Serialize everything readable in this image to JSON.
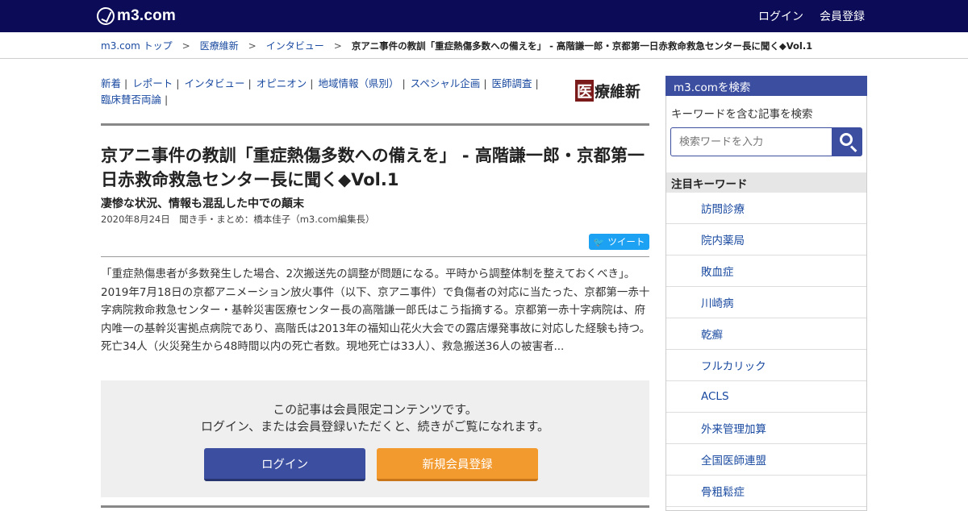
{
  "header": {
    "logo_text": "m3.com",
    "login": "ログイン",
    "register": "会員登録"
  },
  "breadcrumb": {
    "items": [
      "m3.com トップ",
      "医療維新",
      "インタビュー"
    ],
    "separator": ">",
    "current": "京アニ事件の教訓「重症熱傷多数への備えを」 - 高階謙一郎・京都第一日赤救命救急センター長に聞く◆Vol.1"
  },
  "section_nav": {
    "items": [
      "新着",
      "レポート",
      "インタビュー",
      "オピニオン",
      "地域情報（県別）",
      "スペシャル企画",
      "医師調査",
      "臨床賛否両論"
    ],
    "brand_logo": {
      "box_char": "医",
      "rest": "療維新"
    }
  },
  "article": {
    "title": "京アニ事件の教訓「重症熱傷多数への備えを」 - 高階謙一郎・京都第一日赤救命救急センター長に聞く◆Vol.1",
    "subtitle": "凄惨な状況、情報も混乱した中での顛末",
    "meta": "2020年8月24日　聞き手・まとめ：橋本佳子（m3.com編集長）",
    "tweet": "ツイート",
    "excerpt": "「重症熱傷患者が多数発生した場合、2次搬送先の調整が問題になる。平時から調整体制を整えておくべき」。2019年7月18日の京都アニメーション放火事件（以下、京アニ事件）で負傷者の対応に当たった、京都第一赤十字病院救命救急センター・基幹災害医療センター長の高階謙一郎氏はこう指摘する。京都第一赤十字病院は、府内唯一の基幹災害拠点病院であり、高階氏は2013年の福知山花火大会での露店爆発事故に対応した経験も持つ。死亡34人（火災発生から48時間以内の死亡者数。現地死亡は33人）、救急搬送36人の被害者..."
  },
  "members_box": {
    "line1": "この記事は会員限定コンテンツです。",
    "line2": "ログイン、または会員登録いただくと、続きがご覧になれます。",
    "login_button": "ログイン",
    "register_button": "新規会員登録"
  },
  "sidebar": {
    "search_title": "m3.comを検索",
    "search_label": "キーワードを含む記事を検索",
    "search_placeholder": "検索ワードを入力",
    "keywords_title": "注目キーワード",
    "keywords": [
      "訪問診療",
      "院内薬局",
      "敗血症",
      "川崎病",
      "乾癬",
      "フルカリック",
      "ACLS",
      "外来管理加算",
      "全国医師連盟",
      "骨粗鬆症"
    ]
  },
  "colors": {
    "topbar": "#0b0b57",
    "accent": "#3b4ea0",
    "register": "#f39a2e",
    "link": "#1a4aa0",
    "tweet": "#1da1f2"
  }
}
